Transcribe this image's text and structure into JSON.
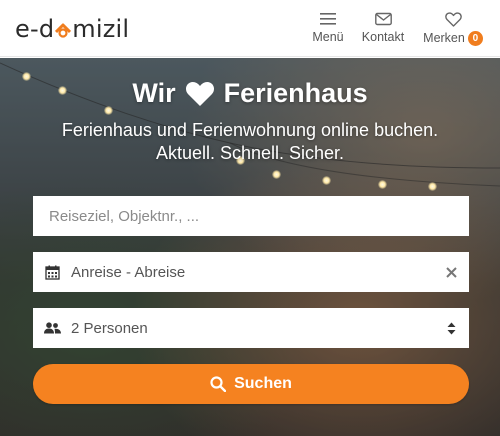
{
  "header": {
    "logo_text": "e-domizil",
    "nav": [
      {
        "label": "Menü",
        "icon": "hamburger-icon"
      },
      {
        "label": "Kontakt",
        "icon": "envelope-icon"
      },
      {
        "label": "Merken",
        "icon": "heart-icon",
        "badge": "0"
      }
    ]
  },
  "hero": {
    "headline_left": "Wir",
    "headline_right": "Ferienhaus",
    "tagline1": "Ferienhaus und Ferienwohnung online buchen.",
    "tagline2": "Aktuell. Schnell. Sicher."
  },
  "search": {
    "destination_placeholder": "Reiseziel, Objektnr., ...",
    "dates_label": "Anreise - Abreise",
    "persons_label": "2 Personen",
    "button_label": "Suchen"
  },
  "colors": {
    "accent": "#f58220",
    "badge": "#f07d1e"
  }
}
